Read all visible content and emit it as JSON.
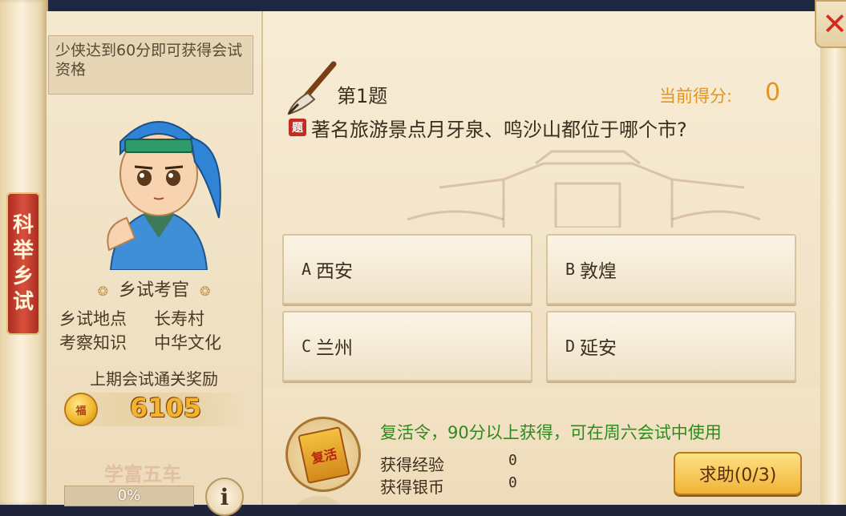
{
  "side_tab": [
    "科",
    "举",
    "乡",
    "试"
  ],
  "left": {
    "hint": "少侠达到60分即可获得会试资格",
    "examiner": "乡试考官",
    "info": [
      {
        "key": "乡试地点",
        "value": "长寿村"
      },
      {
        "key": "考察知识",
        "value": "中华文化"
      }
    ],
    "reward_title": "上期会试通关奖励",
    "coin_icon": "福",
    "reward_amount": "6105",
    "title_badge": "学富五车",
    "progress_text": "0%",
    "progress_fraction": 0,
    "info_button": "i"
  },
  "question": {
    "number": "第1题",
    "score_label": "当前得分:",
    "score_value": "0",
    "tag": "题",
    "text": "著名旅游景点月牙泉、鸣沙山都位于哪个市?",
    "answers": [
      {
        "letter": "A",
        "text": "西安"
      },
      {
        "letter": "B",
        "text": "敦煌"
      },
      {
        "letter": "C",
        "text": "兰州"
      },
      {
        "letter": "D",
        "text": "延安"
      }
    ]
  },
  "bottom": {
    "token_label": "复活",
    "revive_text": "复活令，90分以上获得，可在周六会试中使用",
    "exp_label": "获得经验",
    "exp_value": "0",
    "silver_label": "获得银币",
    "silver_value": "0",
    "help_button": "求助(0/3)"
  },
  "close_label": "✕",
  "colors": {
    "accent_orange": "#e39425",
    "revive_green": "#2e8a1c",
    "tab_red": "#c0392b"
  }
}
